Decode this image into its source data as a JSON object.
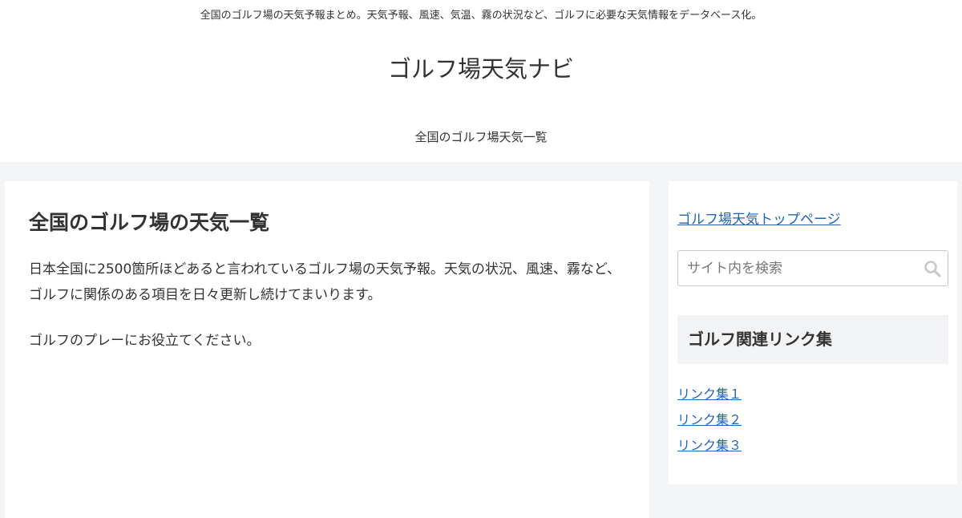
{
  "header": {
    "tagline": "全国のゴルフ場の天気予報まとめ。天気予報、風速、気温、霧の状況など、ゴルフに必要な天気情報をデータベース化。",
    "site_title": "ゴルフ場天気ナビ",
    "nav": [
      "全国のゴルフ場天気一覧"
    ]
  },
  "main": {
    "title": "全国のゴルフ場の天気一覧",
    "paragraphs": [
      "日本全国に2500箇所ほどあると言われているゴルフ場の天気予報。天気の状況、風速、霧など、ゴルフに関係のある項目を日々更新し続けてまいります。",
      "ゴルフのプレーにお役立てください。"
    ]
  },
  "sidebar": {
    "top_link": "ゴルフ場天気トップページ",
    "search": {
      "placeholder": "サイト内を検索",
      "value": "",
      "icon": "search-icon"
    },
    "widget_title": "ゴルフ関連リンク集",
    "links": [
      "リンク集１",
      "リンク集２",
      "リンク集３"
    ]
  },
  "colors": {
    "link": "#2364b5",
    "page_background": "#f4f5f7",
    "widget_heading_background": "#f2f3f5"
  }
}
